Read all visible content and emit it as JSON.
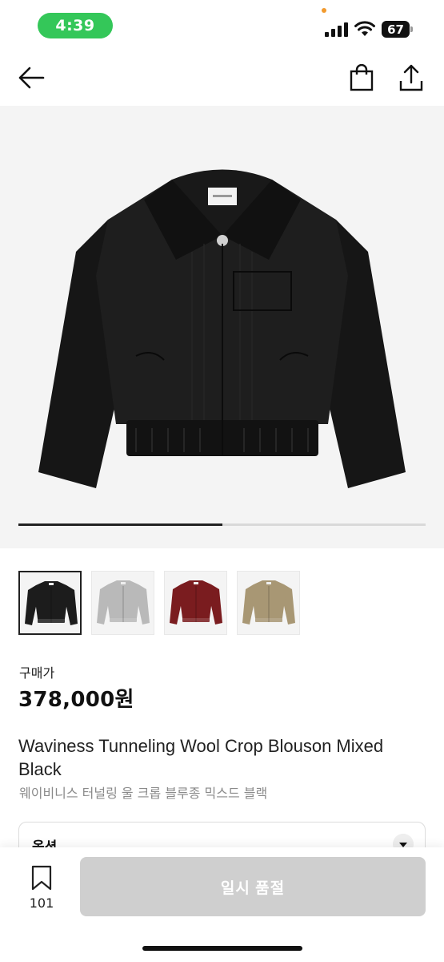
{
  "status_bar": {
    "time": "4:39",
    "battery": "67",
    "time_pill_color": "#34c759"
  },
  "nav": {
    "back_icon": "arrow-left-icon",
    "cart_icon": "shopping-bag-icon",
    "share_icon": "share-icon"
  },
  "gallery": {
    "progress": 0.5,
    "thumbnails": [
      {
        "color_name": "black",
        "color": "#1c1c1c",
        "selected": true
      },
      {
        "color_name": "grey",
        "color": "#b9b9b9",
        "selected": false
      },
      {
        "color_name": "burgundy",
        "color": "#7a1c1f",
        "selected": false
      },
      {
        "color_name": "beige",
        "color": "#a89774",
        "selected": false
      }
    ]
  },
  "product": {
    "price_label": "구매가",
    "price": "378,000원",
    "title_en": "Waviness Tunneling Wool Crop Blouson Mixed Black",
    "title_ko": "웨이비니스 터널링 울 크롭 블루종 믹스드 블랙"
  },
  "option": {
    "label": "옵션",
    "chevron_icon": "chevron-down-icon"
  },
  "bottom_bar": {
    "save_count": "101",
    "save_icon": "bookmark-icon",
    "button_label": "일시 품절"
  }
}
